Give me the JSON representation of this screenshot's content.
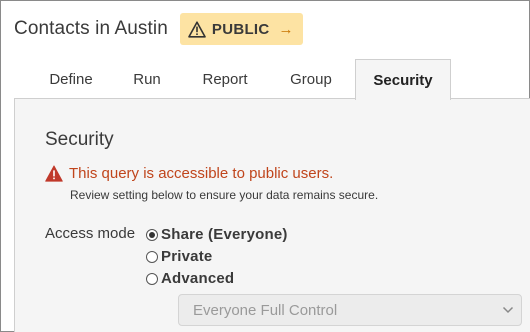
{
  "header": {
    "title": "Contacts in Austin",
    "badge_icon": "warning-triangle-icon",
    "badge_label": "PUBLIC",
    "badge_arrow": "→",
    "badge_color": "#fde3a3"
  },
  "tabs": [
    {
      "label": "Define",
      "active": false
    },
    {
      "label": "Run",
      "active": false
    },
    {
      "label": "Report",
      "active": false
    },
    {
      "label": "Group",
      "active": false
    },
    {
      "label": "Security",
      "active": true
    }
  ],
  "security": {
    "title": "Security",
    "alert_icon": "warning-triangle-icon",
    "alert_message": "This query is accessible to public users.",
    "alert_color": "#c0451c",
    "alert_subtext": "Review setting below to ensure your data remains secure.",
    "access_mode_label": "Access mode",
    "options": [
      {
        "label": "Share (Everyone)",
        "selected": true
      },
      {
        "label": "Private",
        "selected": false
      },
      {
        "label": "Advanced",
        "selected": false
      }
    ],
    "permission_select": {
      "value": "Everyone Full Control",
      "disabled": true
    }
  }
}
